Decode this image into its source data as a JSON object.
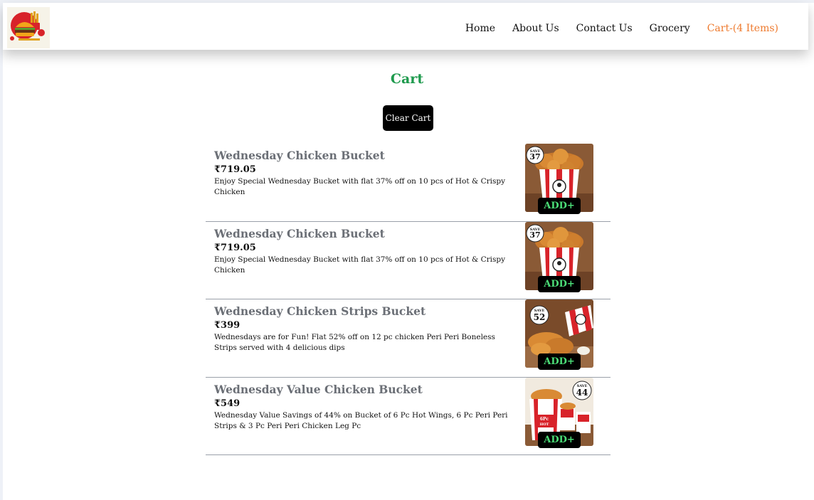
{
  "nav": {
    "links": [
      "Home",
      "About Us",
      "Contact Us",
      "Grocery",
      "Cart-(4 Items)"
    ],
    "active_color": "#ee7a2e"
  },
  "cart": {
    "title": "Cart",
    "clear_label": "Clear Cart",
    "items": [
      {
        "name": "Wednesday Chicken Bucket",
        "price": "₹719.05",
        "description": "Enjoy Special Wednesday Bucket with flat 37% off on 10 pcs of Hot & Crispy Chicken",
        "badge": "37",
        "image": "bucket",
        "add_label": "ADD+"
      },
      {
        "name": "Wednesday Chicken Bucket",
        "price": "₹719.05",
        "description": "Enjoy Special Wednesday Bucket with flat 37% off on 10 pcs of Hot & Crispy Chicken",
        "badge": "37",
        "image": "bucket",
        "add_label": "ADD+"
      },
      {
        "name": "Wednesday Chicken Strips Bucket",
        "price": "₹399",
        "description": "Wednesdays are for Fun! Flat 52% off on 12 pc chicken Peri Peri Boneless Strips served with 4 delicious dips",
        "badge": "52",
        "image": "strips",
        "add_label": "ADD+"
      },
      {
        "name": "Wednesday Value Chicken Bucket",
        "price": "₹549",
        "description": "Wednesday Value Savings of 44% on Bucket of 6 Pc Hot Wings, 6 Pc Peri Peri Strips & 3 Pc Peri Peri Chicken Leg Pc",
        "badge": "44",
        "image": "value",
        "add_label": "ADD+"
      }
    ]
  }
}
